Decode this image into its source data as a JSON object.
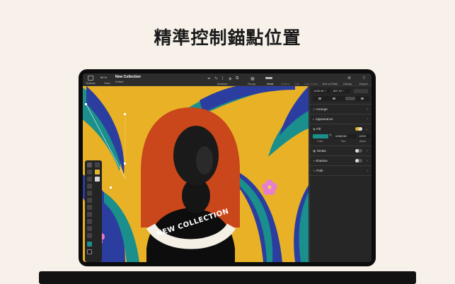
{
  "headline": "精準控制錨點位置",
  "toolbar": {
    "sidebar_label": "Sidebar",
    "view_zoom": "80 %",
    "view_label": "View",
    "doc_title": "New Collection",
    "doc_status": "Edited",
    "boolean_label": "Boolean",
    "group_label": "Group",
    "mask_label": "Mask",
    "outline_label": "Outline",
    "clip_label": "Clip",
    "auto_trace_label": "Auto Trace",
    "text_on_path_label": "Text on Path",
    "library_label": "Library",
    "export_label": "Export"
  },
  "canvas": {
    "artwork_text": "NEW COLLECTION"
  },
  "inspector": {
    "x_value": "1226.39",
    "x_unit": "X",
    "y_value": "807.22",
    "y_unit": "Y",
    "arrange_label": "Arrange",
    "appearance_label": "Appearance",
    "fill_label": "Fill",
    "fill_hex": "#0B828C",
    "fill_opacity": "100%",
    "color_label": "Color",
    "hex_label": "Hex",
    "alpha_label": "Alpha",
    "stroke_label": "Stroke",
    "shadow_label": "Shadow",
    "path_label": "Path",
    "colors": {
      "fill_swatch": "#1a8f8c",
      "toggle_on": "#e0b52d"
    }
  },
  "icons": [
    "sidebar-icon",
    "pen-icon",
    "pencil-icon",
    "brush-icon",
    "node-icon",
    "boolean-icon",
    "group-icon",
    "mask-icon",
    "library-icon",
    "export-icon",
    "arrange-icon",
    "appearance-icon",
    "fill-icon",
    "stroke-icon",
    "shadow-icon",
    "path-icon",
    "eyedropper-icon"
  ]
}
